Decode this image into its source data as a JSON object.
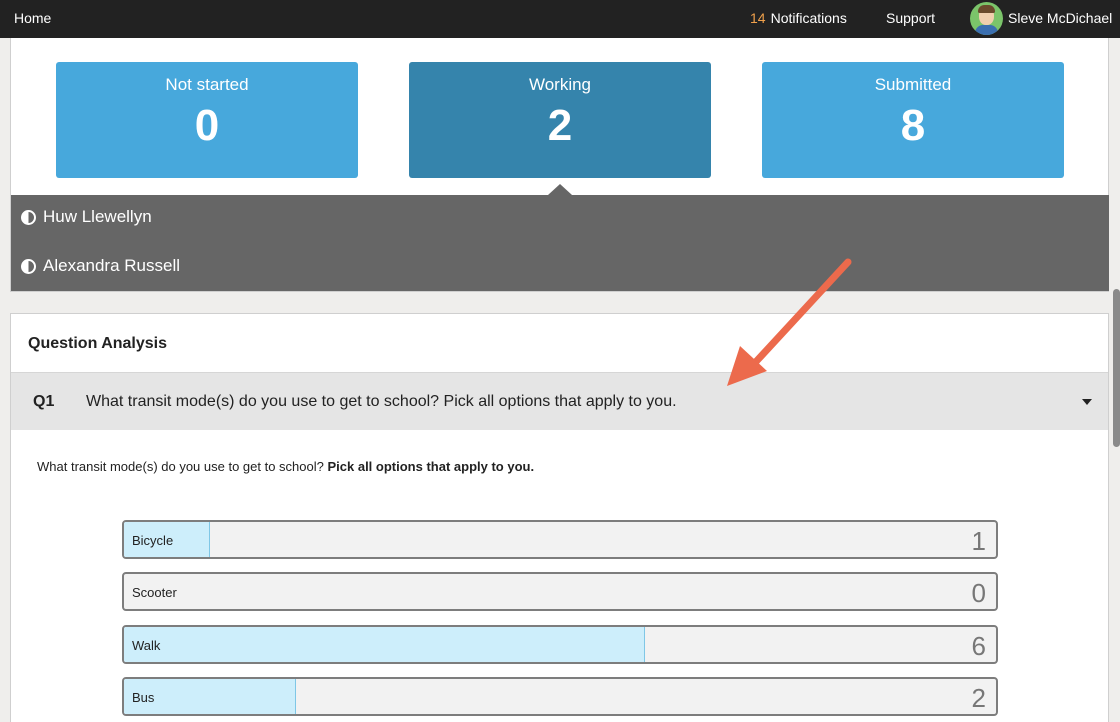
{
  "topbar": {
    "home": "Home",
    "notifications_count": "14",
    "notifications_label": "Notifications",
    "support": "Support",
    "username": "Sleve McDichael"
  },
  "status_cards": [
    {
      "label": "Not started",
      "value": "0",
      "color": "#47a8dc"
    },
    {
      "label": "Working",
      "value": "2",
      "color": "#3584ac",
      "selected": true
    },
    {
      "label": "Submitted",
      "value": "8",
      "color": "#47a8dc"
    }
  ],
  "working_students": [
    {
      "name": "Huw Llewellyn",
      "icon": "half-circle-icon"
    },
    {
      "name": "Alexandra Russell",
      "icon": "half-circle-icon"
    }
  ],
  "analysis": {
    "title": "Question Analysis",
    "question": {
      "number": "Q1",
      "text": "What transit mode(s) do you use to get to school? Pick all options that apply to you.",
      "prompt_plain": "What transit mode(s) do you use to get to school? ",
      "prompt_bold": "Pick all options that apply to you."
    },
    "options": [
      {
        "label": "Bicycle",
        "count": "1",
        "fill_fraction": 0.0985
      },
      {
        "label": "Scooter",
        "count": "0",
        "fill_fraction": 0.0
      },
      {
        "label": "Walk",
        "count": "6",
        "fill_fraction": 0.598
      },
      {
        "label": "Bus",
        "count": "2",
        "fill_fraction": 0.197
      }
    ]
  },
  "colors": {
    "topbar": "#222222",
    "card": "#47a8dc",
    "card_selected": "#3584ac",
    "student_panel": "#666666",
    "bar_fill": "#cdeefb",
    "annotation_arrow": "#ec6a4c"
  }
}
